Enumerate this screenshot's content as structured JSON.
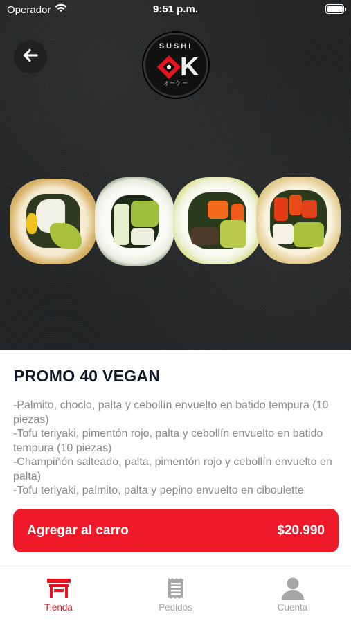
{
  "status_bar": {
    "carrier": "Operador",
    "time": "9:51 p.m."
  },
  "logo": {
    "top_text": "SUSHI",
    "letter": "K",
    "sub_text": "オーケー"
  },
  "product": {
    "title": "PROMO 40 VEGAN",
    "description_lines": [
      "-Palmito, choclo, palta y cebollín envuelto en batido tempura (10 piezas)",
      "-Tofu teriyaki, pimentón rojo, palta y cebollín envuelto en batido tempura (10 piezas)",
      "-Champiñón salteado, palta, pimentón rojo y cebollín envuelto en palta)",
      "-Tofu teriyaki, palmito, palta y pepino envuelto en ciboulette"
    ]
  },
  "cart_button": {
    "label": "Agregar al carro",
    "price": "$20.990"
  },
  "tabs": [
    {
      "label": "Tienda",
      "icon": "store-icon",
      "active": true
    },
    {
      "label": "Pedidos",
      "icon": "receipt-icon",
      "active": false
    },
    {
      "label": "Cuenta",
      "icon": "user-icon",
      "active": false
    }
  ],
  "colors": {
    "accent": "#f0192a",
    "title": "#111827",
    "description": "#8a8a8a",
    "tab_inactive": "#a0a0a0"
  }
}
